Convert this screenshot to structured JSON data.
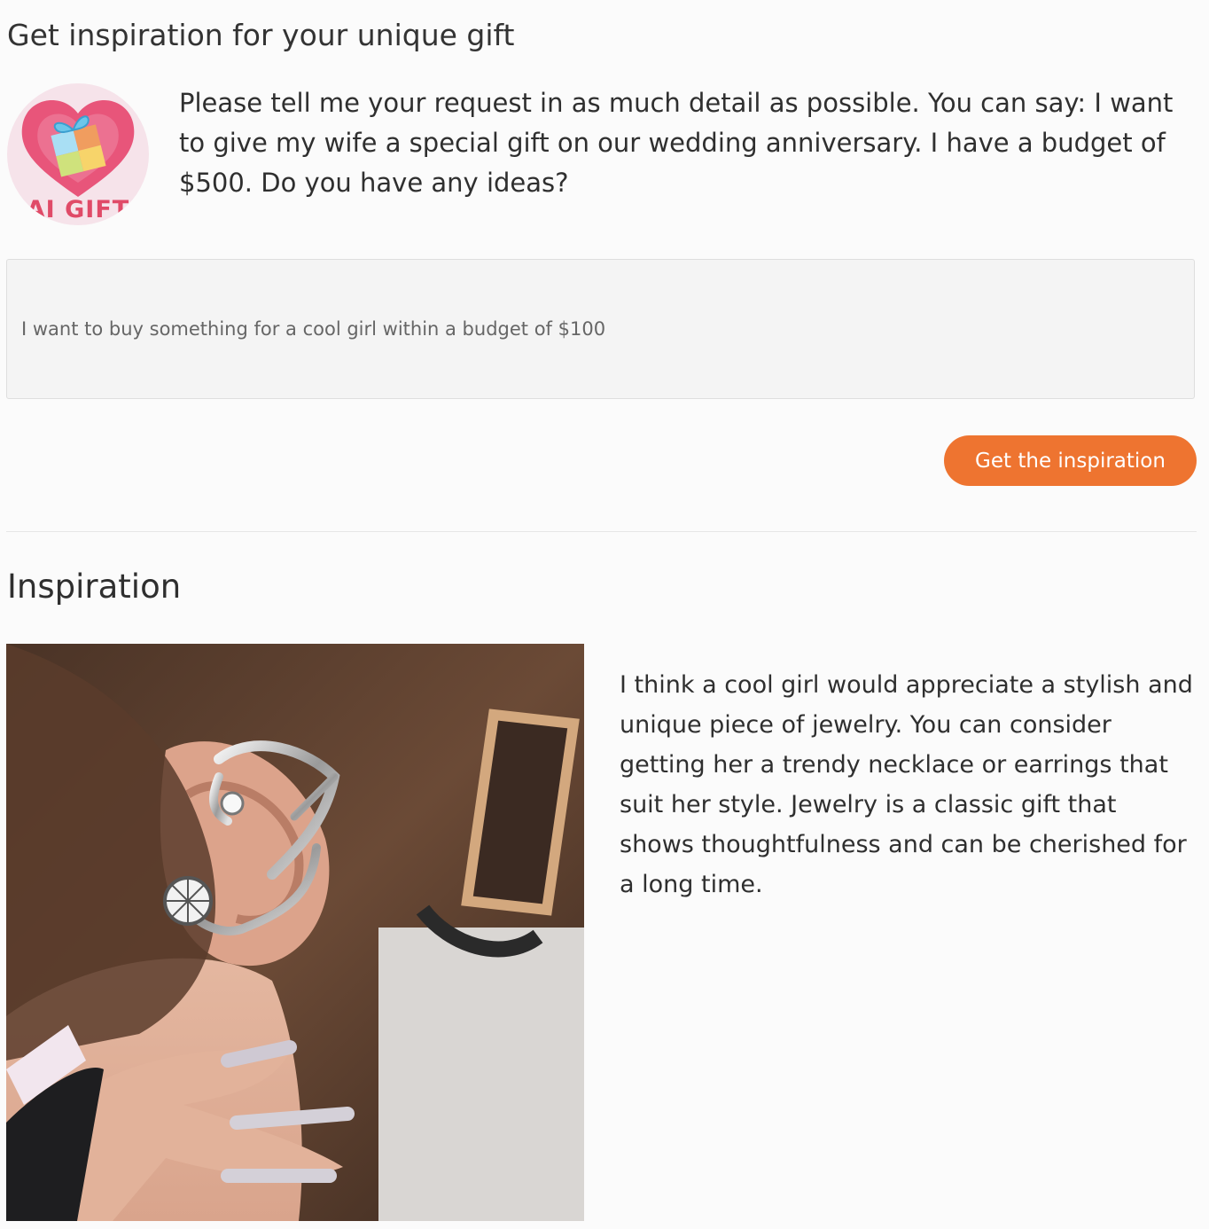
{
  "page": {
    "title": "Get inspiration for your unique gift"
  },
  "intro": {
    "logo_text": "AI GIFT",
    "text": "Please tell me your request in as much detail as possible. You can say: I want to give my wife a special gift on our wedding anniversary. I have a budget of $500. Do you have any ideas?"
  },
  "request": {
    "value": "I want to buy something for a cool girl within a budget of $100",
    "placeholder": ""
  },
  "actions": {
    "submit_label": "Get the inspiration"
  },
  "result": {
    "heading": "Inspiration",
    "text": "I think a cool girl would appreciate a stylish and unique piece of jewelry. You can consider getting her a trendy necklace or earrings that suit her style. Jewelry is a classic gift that shows thoughtfulness and can be cherished for a long time."
  },
  "colors": {
    "accent": "#ee7430",
    "logo_pink": "#e04b68",
    "text": "#2f2f2f"
  },
  "icons": {
    "logo": "ai-gift-heart-logo"
  }
}
